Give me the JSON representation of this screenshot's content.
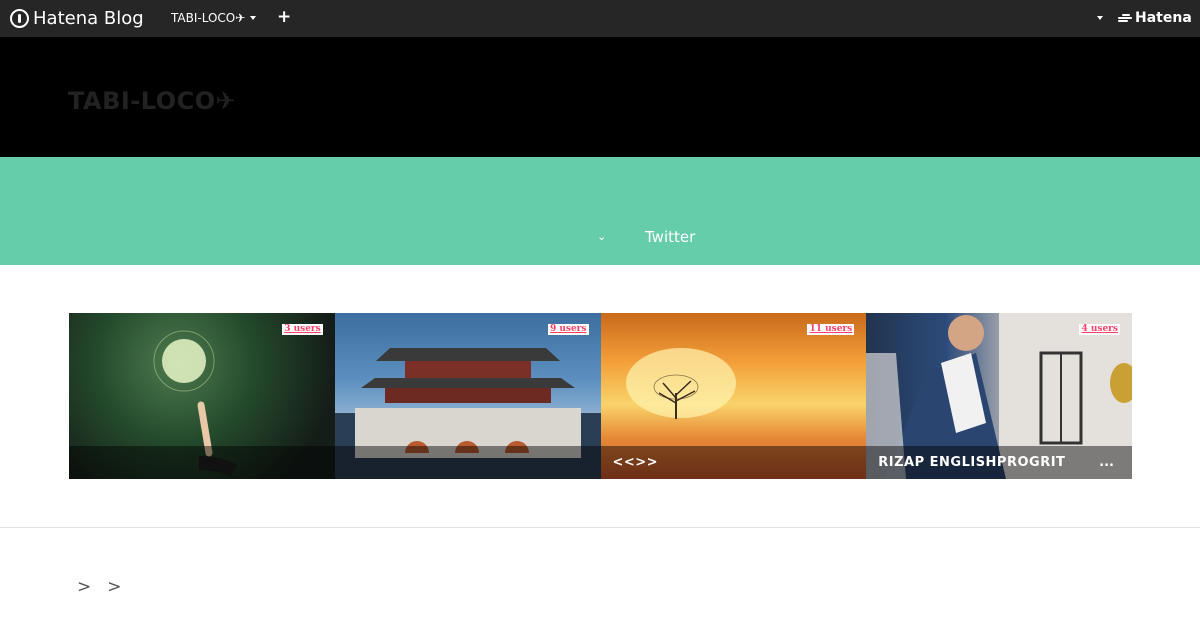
{
  "topbar": {
    "logo_label": "Hatena Blog",
    "blog_switch_label": "TABI-LOCO✈",
    "add_label": "+",
    "hatena_label": "Hatena"
  },
  "header": {
    "blog_title": "TABI-LOCO✈"
  },
  "nav": {
    "chevron": "⌄",
    "twitter_label": "Twitter"
  },
  "cards": [
    {
      "users": "3 users",
      "title": "",
      "more": ""
    },
    {
      "users": "9 users",
      "title": "",
      "more": ""
    },
    {
      "users": "11 users",
      "title": "<<>>",
      "more": ""
    },
    {
      "users": "4 users",
      "title": "RIZAP ENGLISHPROGRIT",
      "more": "..."
    }
  ],
  "breadcrumb": {
    "sep1": ">",
    "sep2": ">"
  },
  "colors": {
    "topbar": "#262626",
    "header_bg": "#000000",
    "green_band": "#66cdaa",
    "users_badge": "#ff4166"
  }
}
